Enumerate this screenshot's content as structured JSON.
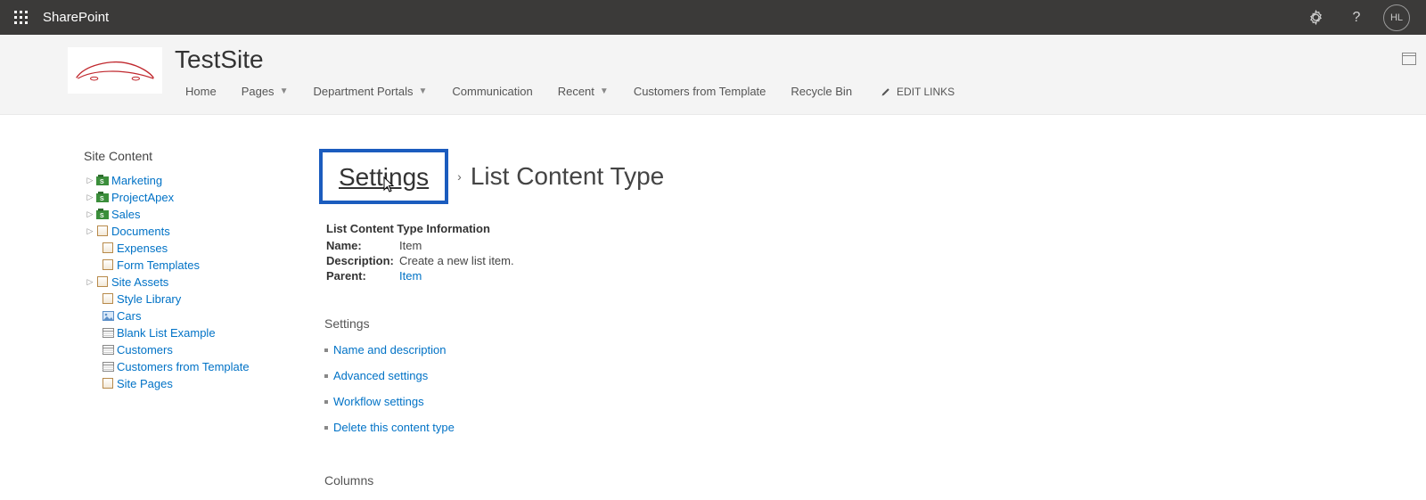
{
  "suite": {
    "brand": "SharePoint",
    "user_initials": "HL"
  },
  "site": {
    "title": "TestSite"
  },
  "topnav": {
    "home": "Home",
    "pages": "Pages",
    "dept": "Department Portals",
    "comm": "Communication",
    "recent": "Recent",
    "cust": "Customers from Template",
    "recycle": "Recycle Bin",
    "edit": "EDIT LINKS"
  },
  "leftnav": {
    "header": "Site Content",
    "items": [
      {
        "label": "Marketing",
        "type": "subsite",
        "expandable": true
      },
      {
        "label": "ProjectApex",
        "type": "subsite",
        "expandable": true
      },
      {
        "label": "Sales",
        "type": "subsite",
        "expandable": true
      },
      {
        "label": "Documents",
        "type": "library",
        "expandable": true
      },
      {
        "label": "Expenses",
        "type": "library",
        "expandable": false,
        "indent": 1
      },
      {
        "label": "Form Templates",
        "type": "library",
        "expandable": false,
        "indent": 1
      },
      {
        "label": "Site Assets",
        "type": "library",
        "expandable": true
      },
      {
        "label": "Style Library",
        "type": "library",
        "expandable": false,
        "indent": 1
      },
      {
        "label": "Cars",
        "type": "pic",
        "expandable": false,
        "indent": 1
      },
      {
        "label": "Blank List Example",
        "type": "list",
        "expandable": false,
        "indent": 1
      },
      {
        "label": "Customers",
        "type": "list",
        "expandable": false,
        "indent": 1
      },
      {
        "label": "Customers from Template",
        "type": "list",
        "expandable": false,
        "indent": 1
      },
      {
        "label": "Site Pages",
        "type": "library",
        "expandable": false,
        "indent": 1
      }
    ]
  },
  "breadcrumb": {
    "settings": "Settings",
    "current": "List Content Type"
  },
  "info": {
    "heading": "List Content Type Information",
    "name_label": "Name:",
    "name_value": "Item",
    "desc_label": "Description:",
    "desc_value": "Create a new list item.",
    "parent_label": "Parent:",
    "parent_value": "Item"
  },
  "sections": {
    "settings_head": "Settings",
    "links": [
      "Name and description",
      "Advanced settings",
      "Workflow settings",
      "Delete this content type"
    ],
    "columns_head": "Columns"
  }
}
